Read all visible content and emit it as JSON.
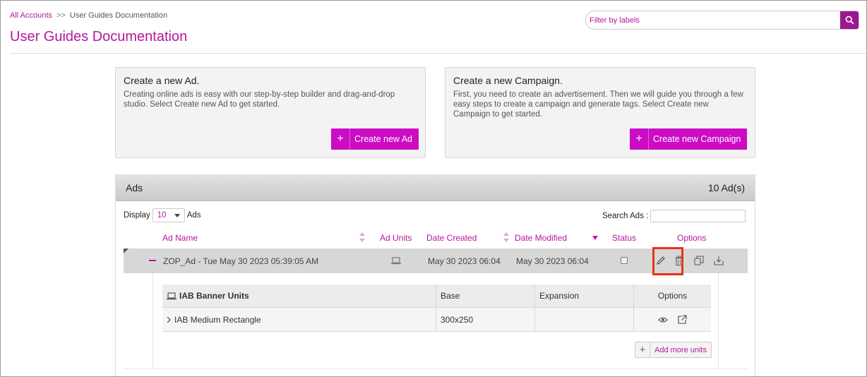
{
  "breadcrumb": {
    "root": "All Accounts",
    "separator": ">>",
    "current": "User Guides Documentation"
  },
  "page_title": "User Guides Documentation",
  "filter": {
    "placeholder": "Filter by labels",
    "icon": "search-icon"
  },
  "cards": {
    "ad": {
      "title": "Create a new Ad.",
      "description": "Creating online ads is easy with our step-by-step builder and drag-and-drop studio. Select Create new Ad to get started.",
      "button_label": "Create new Ad"
    },
    "campaign": {
      "title": "Create a new Campaign.",
      "description": "First, you need to create an advertisement. Then we will guide you through a few easy steps to create a campaign and generate tags. Select Create new Campaign to get started.",
      "button_label": "Create new Campaign"
    }
  },
  "ads_panel": {
    "title": "Ads",
    "count": "10 Ad(s)",
    "display_label": "Display",
    "display_value": "10",
    "display_suffix": "Ads",
    "search_label": "Search Ads :",
    "columns": {
      "ad_name": "Ad Name",
      "ad_units": "Ad Units",
      "date_created": "Date Created",
      "date_modified": "Date Modified",
      "status": "Status",
      "options": "Options"
    },
    "row": {
      "name": "ZOP_Ad - Tue May 30 2023 05:39:05 AM",
      "date_created": "May 30 2023 06:04",
      "date_modified": "May 30 2023 06:04"
    },
    "units_table": {
      "headers": [
        "IAB Banner Units",
        "Base",
        "Expansion",
        "Options"
      ],
      "rows": [
        {
          "name": "IAB Medium Rectangle",
          "base": "300x250",
          "expansion": ""
        }
      ]
    },
    "add_more_label": "Add more units"
  },
  "colors": {
    "accent": "#cc0cc4",
    "link": "#b5179e",
    "highlight": "#e8321a"
  }
}
